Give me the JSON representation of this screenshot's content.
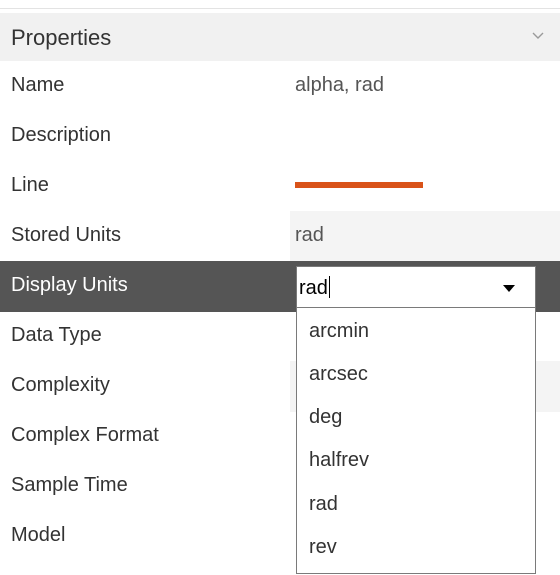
{
  "panel": {
    "title": "Properties",
    "chevron_icon": "chevron-down-icon"
  },
  "rows": [
    {
      "label": "Name",
      "value": "alpha, rad"
    },
    {
      "label": "Description",
      "value": ""
    },
    {
      "label": "Line",
      "value": "",
      "swatch_color": "#d95319"
    },
    {
      "label": "Stored Units",
      "value": "rad"
    },
    {
      "label": "Display Units",
      "value": "rad"
    },
    {
      "label": "Data Type",
      "value": ""
    },
    {
      "label": "Complexity",
      "value": ""
    },
    {
      "label": "Complex Format",
      "value": ""
    },
    {
      "label": "Sample Time",
      "value": ""
    },
    {
      "label": "Model",
      "value": ""
    }
  ],
  "display_units_dropdown": {
    "current_value": "rad",
    "arrow_icon": "dropdown-arrow-icon",
    "options": [
      "arcmin",
      "arcsec",
      "deg",
      "halfrev",
      "rad",
      "rev"
    ]
  },
  "colors": {
    "selected_row": "#555555",
    "line_swatch": "#d95319",
    "header_bg": "#f1f1f1"
  }
}
